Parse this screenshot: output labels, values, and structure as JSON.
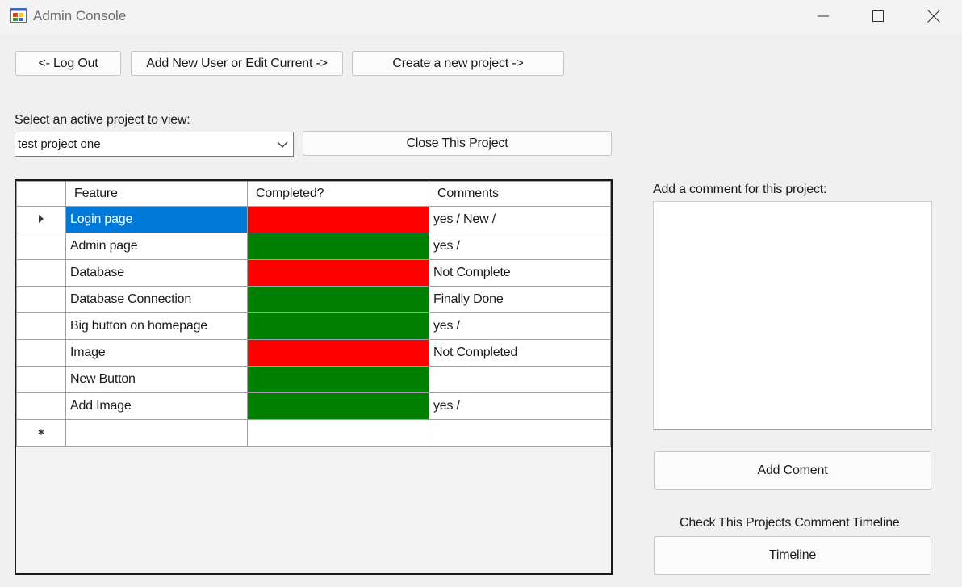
{
  "window": {
    "title": "Admin Console",
    "minimize_icon": "minimize-icon",
    "maximize_icon": "maximize-icon",
    "close_icon": "close-icon"
  },
  "toolbar": {
    "logout_label": "<- Log Out",
    "add_user_label": "Add New User or Edit Current ->",
    "new_project_label": "Create a new project ->"
  },
  "project_select": {
    "label": "Select an active project to view:",
    "selected": "test project one",
    "close_project_label": "Close This Project"
  },
  "grid": {
    "columns": [
      "Feature",
      "Completed?",
      "Comments"
    ],
    "rows": [
      {
        "feature": "Login page",
        "completed": false,
        "comment": "yes / New /",
        "status_color": "#ff0000"
      },
      {
        "feature": "Admin page",
        "completed": true,
        "comment": "yes /",
        "status_color": "#008000"
      },
      {
        "feature": "Database",
        "completed": false,
        "comment": "Not Complete",
        "status_color": "#ff0000"
      },
      {
        "feature": "Database Connection",
        "completed": true,
        "comment": "Finally Done",
        "status_color": "#008000"
      },
      {
        "feature": "Big button on homepage",
        "completed": true,
        "comment": "yes /",
        "status_color": "#008000"
      },
      {
        "feature": "Image",
        "completed": false,
        "comment": "Not Completed",
        "status_color": "#ff0000"
      },
      {
        "feature": "New Button",
        "completed": true,
        "comment": "",
        "status_color": "#008000"
      },
      {
        "feature": "Add Image",
        "completed": true,
        "comment": "yes /",
        "status_color": "#008000"
      }
    ],
    "selected_row": 0,
    "current_row_marker": "current-row-arrow-icon",
    "new_row_marker": "new-row-asterisk-icon"
  },
  "comment_panel": {
    "label": "Add a comment for this project:",
    "value": "",
    "add_button_label": "Add Coment",
    "timeline_label": "Check This Projects Comment Timeline",
    "timeline_button_label": "Timeline"
  },
  "colors": {
    "incomplete": "#ff0000",
    "complete": "#008000",
    "selection": "#0078d7"
  }
}
